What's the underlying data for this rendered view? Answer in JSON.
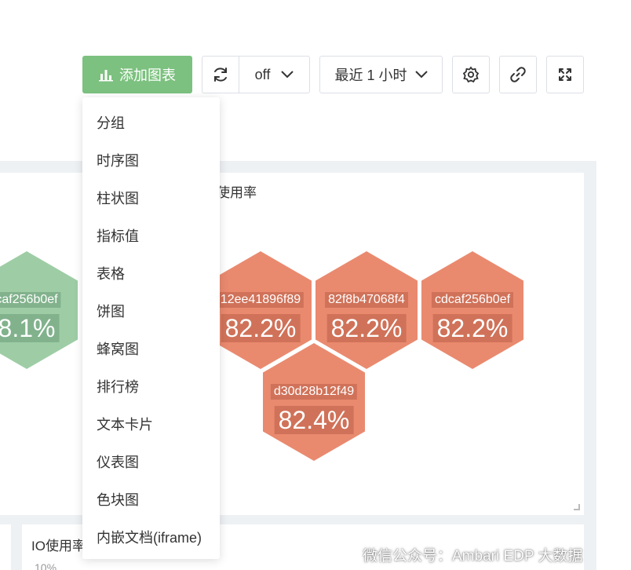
{
  "toolbar": {
    "add_chart_label": "添加图表",
    "refresh_interval": "off",
    "time_range": "最近 1 小时"
  },
  "panel": {
    "title": "使用率",
    "hexagons": [
      {
        "name": "caf256b0ef",
        "value": "8.1%",
        "color": "#9ecda5"
      },
      {
        "name": "12ee41896f89",
        "value": "82.2%",
        "color": "#e98a6f"
      },
      {
        "name": "82f8b47068f4",
        "value": "82.2%",
        "color": "#e98a6f"
      },
      {
        "name": "cdcaf256b0ef",
        "value": "82.2%",
        "color": "#e98a6f"
      },
      {
        "name": "d30d28b12f49",
        "value": "82.4%",
        "color": "#e98a6f"
      }
    ]
  },
  "io_panel": {
    "title": "IO使用率",
    "first_tick": "10%"
  },
  "dropdown": {
    "items": [
      "分组",
      "时序图",
      "柱状图",
      "指标值",
      "表格",
      "饼图",
      "蜂窝图",
      "排行榜",
      "文本卡片",
      "仪表图",
      "色块图",
      "内嵌文档(iframe)"
    ]
  },
  "watermark": "微信公众号：Ambari EDP 大数据",
  "colors": {
    "accent": "#7cc17f",
    "hex_high": "#e98a6f",
    "hex_low": "#9ecda5"
  }
}
